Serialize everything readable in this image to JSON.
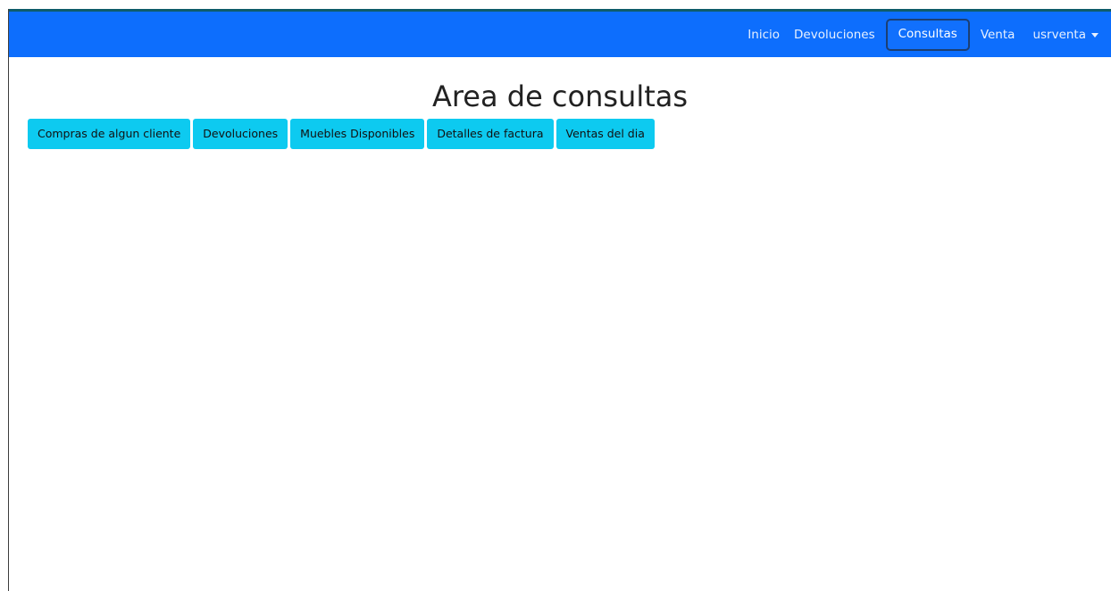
{
  "navbar": {
    "items": [
      {
        "label": "Inicio",
        "active": false
      },
      {
        "label": "Devoluciones",
        "active": false
      },
      {
        "label": "Consultas",
        "active": true
      },
      {
        "label": "Venta",
        "active": false
      }
    ],
    "user": {
      "label": "usrventa"
    },
    "colors": {
      "background": "#0d6efd",
      "text": "#ffffff"
    }
  },
  "main": {
    "title": "Area de consultas",
    "buttons": [
      {
        "label": "Compras de algun cliente"
      },
      {
        "label": "Devoluciones"
      },
      {
        "label": "Muebles Disponibles"
      },
      {
        "label": "Detalles de factura"
      },
      {
        "label": "Ventas del dia"
      }
    ],
    "button_color": "#0dcaf0"
  }
}
